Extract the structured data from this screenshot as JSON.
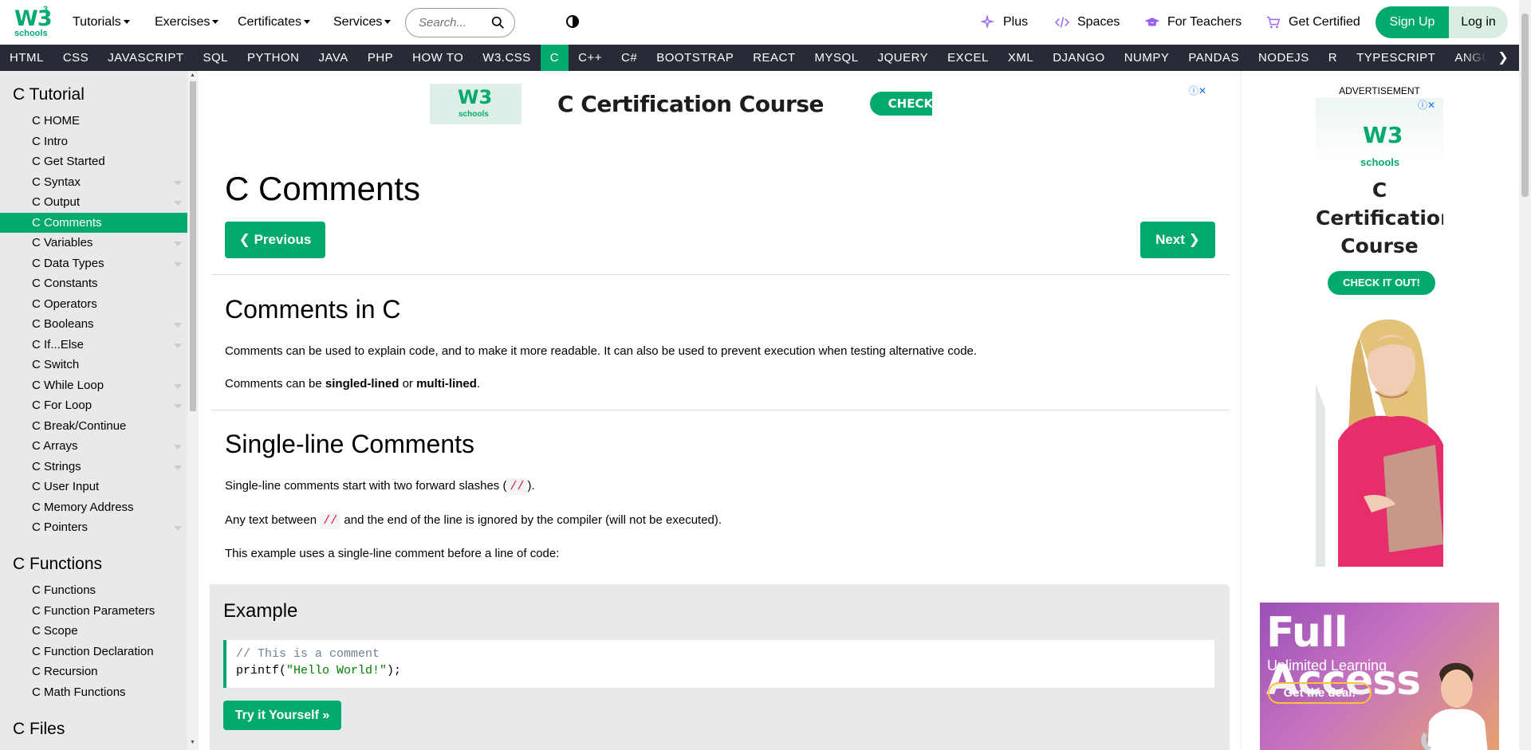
{
  "header": {
    "logo_text": "W3",
    "logo_sup": "3",
    "logo_sub": "schools",
    "menus": [
      "Tutorials",
      "Exercises",
      "Certificates",
      "Services"
    ],
    "search_placeholder": "Search...",
    "links": [
      "Plus",
      "Spaces",
      "For Teachers",
      "Get Certified"
    ],
    "signup": "Sign Up",
    "login": "Log in"
  },
  "nav": {
    "items": [
      "HTML",
      "CSS",
      "JAVASCRIPT",
      "SQL",
      "PYTHON",
      "JAVA",
      "PHP",
      "HOW TO",
      "W3.CSS",
      "C",
      "C++",
      "C#",
      "BOOTSTRAP",
      "REACT",
      "MYSQL",
      "JQUERY",
      "EXCEL",
      "XML",
      "DJANGO",
      "NUMPY",
      "PANDAS",
      "NODEJS",
      "R",
      "TYPESCRIPT",
      "ANGULAR"
    ],
    "active": "C",
    "more_icon": "❯"
  },
  "sidebar": {
    "section1_title": "C Tutorial",
    "section1_items": [
      "C HOME",
      "C Intro",
      "C Get Started",
      "C Syntax",
      "C Output",
      "C Comments",
      "C Variables",
      "C Data Types",
      "C Constants",
      "C Operators",
      "C Booleans",
      "C If...Else",
      "C Switch",
      "C While Loop",
      "C For Loop",
      "C Break/Continue",
      "C Arrays",
      "C Strings",
      "C User Input",
      "C Memory Address",
      "C Pointers"
    ],
    "section1_dropdowns": [
      "C Syntax",
      "C Output",
      "C Variables",
      "C Data Types",
      "C Booleans",
      "C If...Else",
      "C While Loop",
      "C For Loop",
      "C Arrays",
      "C Strings",
      "C Pointers"
    ],
    "section1_active": "C Comments",
    "section2_title": "C Functions",
    "section2_items": [
      "C Functions",
      "C Function Parameters",
      "C Scope",
      "C Function Declaration",
      "C Recursion",
      "C Math Functions"
    ],
    "section3_title": "C Files"
  },
  "banner_ad": {
    "logo": "W3",
    "logo_sup": "3",
    "logo_sub": "schools",
    "title": "C Certification Course",
    "button": "CHECK IT OUT!",
    "close": "ⓘ✕"
  },
  "main": {
    "title": "C Comments",
    "prev_button": "❮ Previous",
    "next_button": "Next ❯",
    "sec1_heading": "Comments in C",
    "sec1_p1": "Comments can be used to explain code, and to make it more readable. It can also be used to prevent execution when testing alternative code.",
    "sec1_p2_a": "Comments can be ",
    "sec1_p2_b": "singled-lined",
    "sec1_p2_c": " or ",
    "sec1_p2_d": "multi-lined",
    "sec1_p2_e": ".",
    "sec2_heading": "Single-line Comments",
    "sec2_p1_a": "Single-line comments start with two forward slashes (",
    "sec2_p1_code": "//",
    "sec2_p1_b": ").",
    "sec2_p2_a": "Any text between ",
    "sec2_p2_code": "//",
    "sec2_p2_b": " and the end of the line is ignored by the compiler (will not be executed).",
    "sec2_p3": "This example uses a single-line comment before a line of code:",
    "example_heading": "Example",
    "code_line1": "// This is a comment",
    "code_line2_a": "printf(",
    "code_line2_str": "\"Hello World!\"",
    "code_line2_b": ");",
    "tryit": "Try it Yourself »"
  },
  "right_ad": {
    "label": "ADVERTISEMENT",
    "logo": "W3",
    "logo_sup": "3",
    "logo_sub": "schools",
    "title": "C Certification Course",
    "button": "CHECK IT OUT!",
    "close": "ⓘ✕"
  },
  "promo": {
    "title": "Full Access",
    "subtitle": "Unlimited Learning",
    "button": "Get the deal!"
  },
  "colors": {
    "brand_green": "#04AA6D",
    "nav_dark": "#282A35",
    "sidebar_bg": "#E7E9EB"
  }
}
